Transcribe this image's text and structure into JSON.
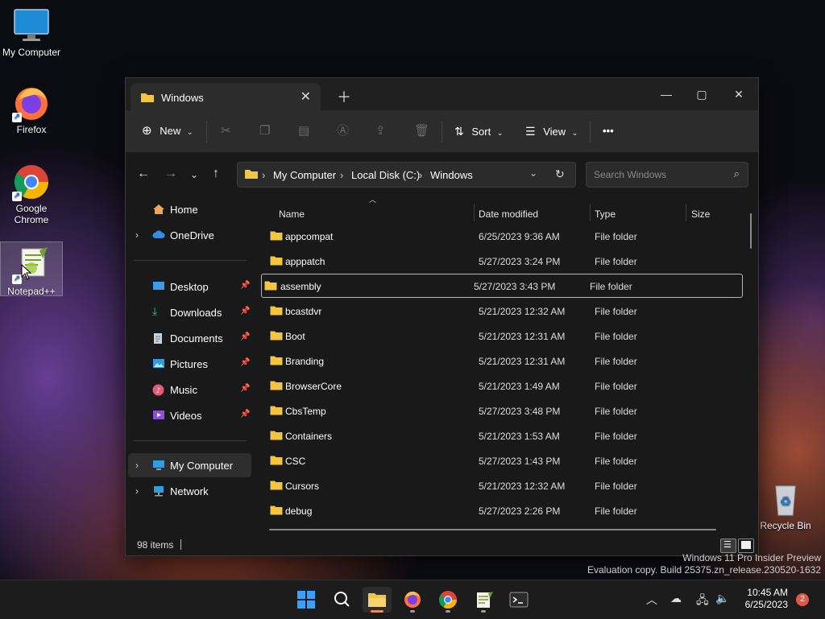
{
  "desktop": {
    "icons": [
      {
        "label": "My Computer"
      },
      {
        "label": "Firefox"
      },
      {
        "label": "Google Chrome"
      },
      {
        "label": "Notepad++"
      },
      {
        "label": "Recycle Bin"
      }
    ]
  },
  "explorer": {
    "tab_title": "Windows",
    "toolbar": {
      "new_label": "New",
      "sort_label": "Sort",
      "view_label": "View",
      "more_label": "•••"
    },
    "breadcrumb": [
      "My Computer",
      "Local Disk (C:)",
      "Windows"
    ],
    "search_placeholder": "Search Windows",
    "nav": {
      "home": "Home",
      "onedrive": "OneDrive",
      "desktop": "Desktop",
      "downloads": "Downloads",
      "documents": "Documents",
      "pictures": "Pictures",
      "music": "Music",
      "videos": "Videos",
      "my_computer": "My Computer",
      "network": "Network"
    },
    "columns": {
      "name": "Name",
      "date": "Date modified",
      "type": "Type",
      "size": "Size"
    },
    "rows": [
      {
        "name": "appcompat",
        "date": "6/25/2023 9:36 AM",
        "type": "File folder"
      },
      {
        "name": "apppatch",
        "date": "5/27/2023 3:24 PM",
        "type": "File folder"
      },
      {
        "name": "assembly",
        "date": "5/27/2023 3:43 PM",
        "type": "File folder"
      },
      {
        "name": "bcastdvr",
        "date": "5/21/2023 12:32 AM",
        "type": "File folder"
      },
      {
        "name": "Boot",
        "date": "5/21/2023 12:31 AM",
        "type": "File folder"
      },
      {
        "name": "Branding",
        "date": "5/21/2023 12:31 AM",
        "type": "File folder"
      },
      {
        "name": "BrowserCore",
        "date": "5/21/2023 1:49 AM",
        "type": "File folder"
      },
      {
        "name": "CbsTemp",
        "date": "5/27/2023 3:48 PM",
        "type": "File folder"
      },
      {
        "name": "Containers",
        "date": "5/21/2023 1:53 AM",
        "type": "File folder"
      },
      {
        "name": "CSC",
        "date": "5/27/2023 1:43 PM",
        "type": "File folder"
      },
      {
        "name": "Cursors",
        "date": "5/21/2023 12:32 AM",
        "type": "File folder"
      },
      {
        "name": "debug",
        "date": "5/27/2023 2:26 PM",
        "type": "File folder"
      }
    ],
    "status": {
      "item_count": "98 items"
    }
  },
  "watermark": {
    "line1": "Windows 11 Pro Insider Preview",
    "line2": "Evaluation copy. Build 25375.zn_release.230520-1632"
  },
  "taskbar": {
    "time": "10:45 AM",
    "date": "6/25/2023",
    "notification_count": "2"
  },
  "colors": {
    "folder": "#f4c542",
    "accent": "#f08a53",
    "window_bg": "#191919"
  }
}
